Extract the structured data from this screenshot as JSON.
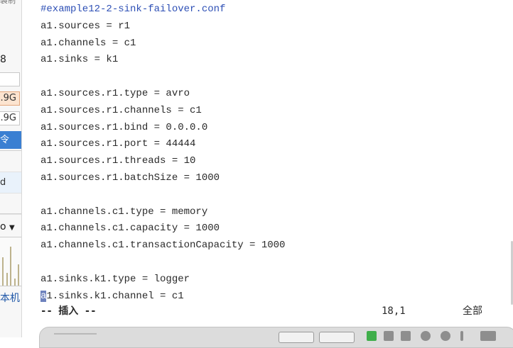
{
  "sidebar": {
    "top_text": "製制",
    "count_text": "8",
    "size_primary": ".9G",
    "size_secondary": ".9G",
    "selected_text": "令",
    "rows": [
      "",
      "d",
      "",
      ""
    ],
    "dropdown_label": "o",
    "machine_label": "本机"
  },
  "editor": {
    "comment_line": "#example12-2-sink-failover.conf",
    "lines": [
      "a1.sources = r1",
      "a1.channels = c1",
      "a1.sinks = k1",
      "",
      "a1.sources.r1.type = avro",
      "a1.sources.r1.channels = c1",
      "a1.sources.r1.bind = 0.0.0.0",
      "a1.sources.r1.port = 44444",
      "a1.sources.r1.threads = 10",
      "a1.sources.r1.batchSize = 1000",
      "",
      "a1.channels.c1.type = memory",
      "a1.channels.c1.capacity = 1000",
      "a1.channels.c1.transactionCapacity = 1000",
      "",
      "a1.sinks.k1.type = logger"
    ],
    "cursor_char": "a",
    "cursor_line_rest": "1.sinks.k1.channel = c1",
    "status": {
      "mode": "-- 插入 --",
      "position": "18,1",
      "scope": "全部"
    }
  },
  "colors": {
    "comment": "#2d4fb5",
    "cursor": "#6e82bd",
    "selected_blue": "#3a7fd2",
    "size_highlight": "#fce4d0"
  }
}
